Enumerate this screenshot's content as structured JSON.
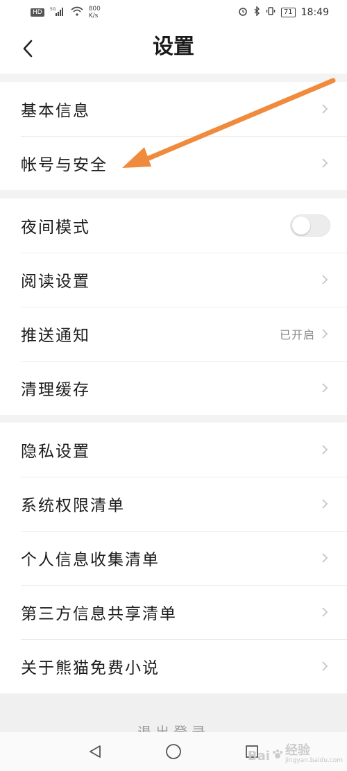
{
  "status_bar": {
    "hd_badge": "HD",
    "network": "5G",
    "speed_value": "800",
    "speed_unit": "K/s",
    "battery": "71",
    "time": "18:49",
    "icons": [
      "signal-icon",
      "wifi-icon",
      "alarm-icon",
      "bluetooth-icon",
      "vibrate-icon",
      "battery-icon"
    ]
  },
  "header": {
    "title": "设置",
    "back_icon": "chevron-left-icon"
  },
  "group1": {
    "items": [
      {
        "label": "基本信息"
      },
      {
        "label": "帐号与安全"
      }
    ]
  },
  "group2": {
    "items": [
      {
        "label": "夜间模式",
        "toggle_on": false
      },
      {
        "label": "阅读设置"
      },
      {
        "label": "推送通知",
        "value": "已开启"
      },
      {
        "label": "清理缓存"
      }
    ]
  },
  "group3": {
    "items": [
      {
        "label": "隐私设置"
      },
      {
        "label": "系统权限清单"
      },
      {
        "label": "个人信息收集清单"
      },
      {
        "label": "第三方信息共享清单"
      },
      {
        "label": "关于熊猫免费小说"
      }
    ]
  },
  "bottom": {
    "logout_peek": "退出登录"
  },
  "nav_bar": {
    "icons": [
      "back-triangle-icon",
      "home-circle-icon",
      "recents-square-icon"
    ]
  },
  "annotation": {
    "arrow_color": "#f08a3c"
  },
  "watermark": {
    "brand": "Bai",
    "suffix": "经验",
    "sub": "jingyan.baidu.com"
  },
  "colors": {
    "background": "#f3f3f3",
    "surface": "#ffffff",
    "text": "#1c1c1c",
    "muted": "#888888",
    "divider": "#ececec"
  }
}
